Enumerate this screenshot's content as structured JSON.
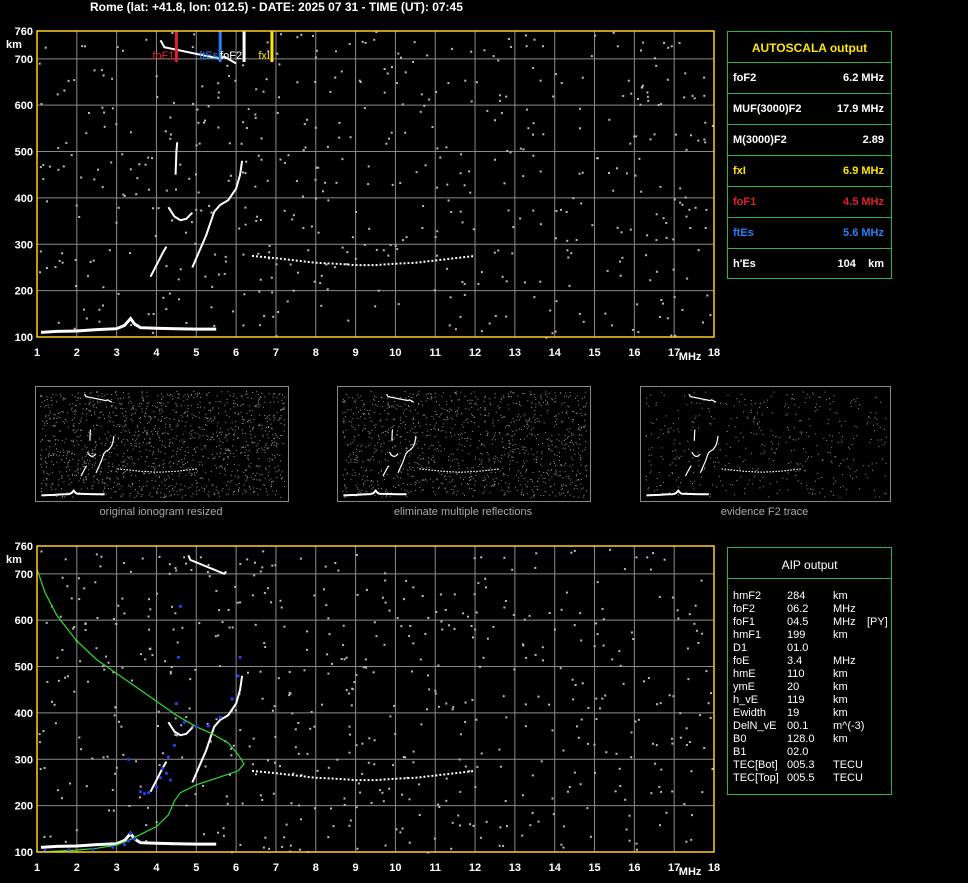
{
  "header": "Rome (lat: +41.8, lon: 012.5) - DATE: 2025 07 31 - TIME (UT): 07:45",
  "colors": {
    "axis": "#ffd11a",
    "grid": "#8a8a8a",
    "panel": "#2db34a",
    "fof1": "#e0202a",
    "ftes": "#2a7ff5",
    "fof2": "#ffffff",
    "fxi": "#ffe40a",
    "profile": "#2fdc2f",
    "points": "#2a3df5"
  },
  "chart_data": [
    {
      "type": "scatter",
      "name": "top-ionogram",
      "xlabel": "MHz",
      "ylabel": "km",
      "xlim": [
        1,
        18
      ],
      "ylim": [
        100,
        760
      ],
      "x_ticks": [
        "1",
        "2",
        "3",
        "4",
        "5",
        "6",
        "7",
        "8",
        "9",
        "10",
        "11",
        "12",
        "13",
        "14",
        "15",
        "16",
        "17",
        "18"
      ],
      "y_ticks": [
        "100",
        "200",
        "300",
        "400",
        "500",
        "600",
        "700",
        "760"
      ],
      "grid": true,
      "markers": [
        {
          "label": "foF1",
          "x": 4.5,
          "color": "#e0202a"
        },
        {
          "label": "ftEs",
          "x": 5.6,
          "color": "#2a7ff5"
        },
        {
          "label": "foF2",
          "x": 6.2,
          "color": "#ffffff"
        },
        {
          "label": "fxI",
          "x": 6.9,
          "color": "#ffe40a"
        }
      ],
      "traces": {
        "es_layer": [
          [
            1.1,
            110
          ],
          [
            1.5,
            112
          ],
          [
            2,
            113
          ],
          [
            2.5,
            116
          ],
          [
            3,
            118
          ],
          [
            3.2,
            125
          ],
          [
            3.35,
            140
          ],
          [
            3.45,
            128
          ],
          [
            3.6,
            120
          ],
          [
            4,
            119
          ],
          [
            4.5,
            118
          ],
          [
            5,
            117
          ],
          [
            5.5,
            117
          ]
        ],
        "f1_trace": [
          [
            3.85,
            230
          ],
          [
            4.0,
            255
          ],
          [
            4.15,
            280
          ],
          [
            4.25,
            295
          ]
        ],
        "f2_lower": [
          [
            4.9,
            250
          ],
          [
            5.05,
            280
          ],
          [
            5.15,
            300
          ],
          [
            5.25,
            320
          ],
          [
            5.35,
            345
          ],
          [
            5.45,
            370
          ],
          [
            5.6,
            385
          ],
          [
            5.8,
            395
          ],
          [
            6.0,
            420
          ],
          [
            6.1,
            450
          ],
          [
            6.15,
            480
          ]
        ],
        "f1_cusp": [
          [
            4.3,
            380
          ],
          [
            4.45,
            360
          ],
          [
            4.6,
            352
          ],
          [
            4.75,
            355
          ],
          [
            4.9,
            368
          ]
        ],
        "high_spike": [
          [
            4.48,
            450
          ],
          [
            4.5,
            500
          ],
          [
            4.52,
            520
          ]
        ],
        "top_marks": [
          [
            4.1,
            740
          ],
          [
            4.2,
            725
          ],
          [
            5.6,
            700
          ],
          [
            5.7,
            705
          ],
          [
            6.0,
            690
          ]
        ],
        "f_echo": [
          [
            6.4,
            275
          ],
          [
            7,
            270
          ],
          [
            7.5,
            265
          ],
          [
            8,
            260
          ],
          [
            8.5,
            258
          ],
          [
            9,
            255
          ],
          [
            9.5,
            255
          ],
          [
            10,
            258
          ],
          [
            10.5,
            260
          ],
          [
            11,
            265
          ],
          [
            11.5,
            270
          ],
          [
            12,
            275
          ]
        ]
      }
    },
    {
      "type": "scatter",
      "name": "bottom-ionogram",
      "xlabel": "MHz",
      "ylabel": "km",
      "xlim": [
        1,
        18
      ],
      "ylim": [
        100,
        760
      ],
      "x_ticks": [
        "1",
        "2",
        "3",
        "4",
        "5",
        "6",
        "7",
        "8",
        "9",
        "10",
        "11",
        "12",
        "13",
        "14",
        "15",
        "16",
        "17",
        "18"
      ],
      "y_ticks": [
        "100",
        "200",
        "300",
        "400",
        "500",
        "600",
        "700",
        "760"
      ],
      "grid": true,
      "profile": [
        [
          1.0,
          710
        ],
        [
          1.2,
          660
        ],
        [
          1.5,
          610
        ],
        [
          2,
          555
        ],
        [
          2.5,
          515
        ],
        [
          3,
          485
        ],
        [
          3.5,
          455
        ],
        [
          4,
          425
        ],
        [
          4.5,
          395
        ],
        [
          5,
          370
        ],
        [
          5.4,
          355
        ],
        [
          5.8,
          335
        ],
        [
          6.05,
          310
        ],
        [
          6.2,
          290
        ],
        [
          6.05,
          275
        ],
        [
          5.6,
          262
        ],
        [
          5.0,
          245
        ],
        [
          4.6,
          228
        ],
        [
          4.45,
          210
        ],
        [
          4.3,
          180
        ],
        [
          4.0,
          155
        ],
        [
          3.6,
          138
        ],
        [
          3.3,
          125
        ],
        [
          3.0,
          115
        ],
        [
          2.5,
          108
        ],
        [
          2.0,
          104
        ],
        [
          1.5,
          102
        ],
        [
          1.0,
          100
        ]
      ],
      "points": [
        [
          1.2,
          103
        ],
        [
          1.8,
          104
        ],
        [
          2.4,
          106
        ],
        [
          2.9,
          110
        ],
        [
          3.2,
          116
        ],
        [
          3.3,
          124
        ],
        [
          3.35,
          140
        ],
        [
          3.45,
          128
        ],
        [
          3.7,
          226
        ],
        [
          3.8,
          228
        ],
        [
          4.0,
          240
        ],
        [
          4.1,
          260
        ],
        [
          4.15,
          280
        ],
        [
          4.3,
          305
        ],
        [
          4.45,
          330
        ],
        [
          4.5,
          420
        ],
        [
          4.55,
          520
        ],
        [
          4.6,
          630
        ],
        [
          4.7,
          380
        ],
        [
          5.0,
          370
        ],
        [
          5.3,
          372
        ],
        [
          5.6,
          390
        ],
        [
          5.9,
          430
        ],
        [
          6.05,
          480
        ],
        [
          6.1,
          520
        ],
        [
          4.25,
          270
        ],
        [
          4.35,
          255
        ],
        [
          3.3,
          300
        ],
        [
          3.6,
          230
        ]
      ],
      "traces": {
        "es_layer": [
          [
            1.1,
            110
          ],
          [
            1.5,
            112
          ],
          [
            2,
            113
          ],
          [
            2.5,
            116
          ],
          [
            3,
            118
          ],
          [
            3.2,
            125
          ],
          [
            3.35,
            140
          ],
          [
            3.45,
            128
          ],
          [
            3.6,
            120
          ],
          [
            4,
            119
          ],
          [
            4.5,
            118
          ],
          [
            5,
            117
          ],
          [
            5.5,
            117
          ]
        ],
        "f1_trace": [
          [
            3.85,
            230
          ],
          [
            4.0,
            255
          ],
          [
            4.15,
            280
          ],
          [
            4.25,
            295
          ]
        ],
        "f2_lower": [
          [
            4.9,
            250
          ],
          [
            5.05,
            280
          ],
          [
            5.15,
            300
          ],
          [
            5.25,
            320
          ],
          [
            5.35,
            345
          ],
          [
            5.45,
            370
          ],
          [
            5.6,
            385
          ],
          [
            5.8,
            395
          ],
          [
            6.0,
            420
          ],
          [
            6.1,
            450
          ],
          [
            6.15,
            480
          ]
        ],
        "f1_cusp": [
          [
            4.3,
            380
          ],
          [
            4.45,
            360
          ],
          [
            4.6,
            352
          ],
          [
            4.75,
            355
          ],
          [
            4.9,
            368
          ]
        ],
        "top_marks": [
          [
            4.8,
            740
          ],
          [
            4.85,
            730
          ],
          [
            5.7,
            700
          ],
          [
            5.75,
            705
          ]
        ],
        "f_echo": [
          [
            6.4,
            275
          ],
          [
            7,
            270
          ],
          [
            7.5,
            265
          ],
          [
            8,
            260
          ],
          [
            8.5,
            258
          ],
          [
            9,
            255
          ],
          [
            9.5,
            255
          ],
          [
            10,
            258
          ],
          [
            10.5,
            260
          ],
          [
            11,
            265
          ],
          [
            11.5,
            270
          ],
          [
            12,
            275
          ]
        ]
      }
    }
  ],
  "thumbnails": [
    {
      "caption": "original ionogram resized"
    },
    {
      "caption": "eliminate multiple reflections"
    },
    {
      "caption": "evidence F2 trace"
    }
  ],
  "autoscala": {
    "title": "AUTOSCALA output",
    "rows": [
      {
        "label": "foF2",
        "value": "6.2 MHz",
        "color": "#ffffff"
      },
      {
        "label": "MUF(3000)F2",
        "value": "17.9 MHz",
        "color": "#ffffff"
      },
      {
        "label": "M(3000)F2",
        "value": "2.89",
        "color": "#ffffff"
      },
      {
        "label": "fxI",
        "value": "6.9 MHz",
        "color": "#ffe40a"
      },
      {
        "label": "foF1",
        "value": "4.5 MHz",
        "color": "#e0202a"
      },
      {
        "label": "ftEs",
        "value": "5.6 MHz",
        "color": "#2a7ff5"
      },
      {
        "label": "h'Es",
        "value": "104    km",
        "color": "#ffffff"
      }
    ]
  },
  "aip": {
    "title": "AIP output",
    "rows": [
      {
        "name": "hmF2",
        "value": "284",
        "unit": "km",
        "extra": ""
      },
      {
        "name": "foF2",
        "value": "06.2",
        "unit": "MHz",
        "extra": ""
      },
      {
        "name": "foF1",
        "value": "04.5",
        "unit": "MHz",
        "extra": "[PY]"
      },
      {
        "name": "hmF1",
        "value": "199",
        "unit": "km",
        "extra": ""
      },
      {
        "name": "D1",
        "value": "01.0",
        "unit": "",
        "extra": ""
      },
      {
        "name": "foE",
        "value": "3.4",
        "unit": "MHz",
        "extra": ""
      },
      {
        "name": "hmE",
        "value": "110",
        "unit": "km",
        "extra": ""
      },
      {
        "name": "ymE",
        "value": "20",
        "unit": "km",
        "extra": ""
      },
      {
        "name": "h_vE",
        "value": "119",
        "unit": "km",
        "extra": ""
      },
      {
        "name": "Ewidth",
        "value": "19",
        "unit": "km",
        "extra": ""
      },
      {
        "name": "DelN_vE",
        "value": "00.1",
        "unit": "m^(-3)",
        "extra": ""
      },
      {
        "name": "B0",
        "value": "128.0",
        "unit": "km",
        "extra": ""
      },
      {
        "name": "B1",
        "value": "02.0",
        "unit": "",
        "extra": ""
      },
      {
        "name": "TEC[Bot]",
        "value": "005.3",
        "unit": "TECU",
        "extra": ""
      },
      {
        "name": "TEC[Top]",
        "value": "005.5",
        "unit": "TECU",
        "extra": ""
      }
    ]
  }
}
